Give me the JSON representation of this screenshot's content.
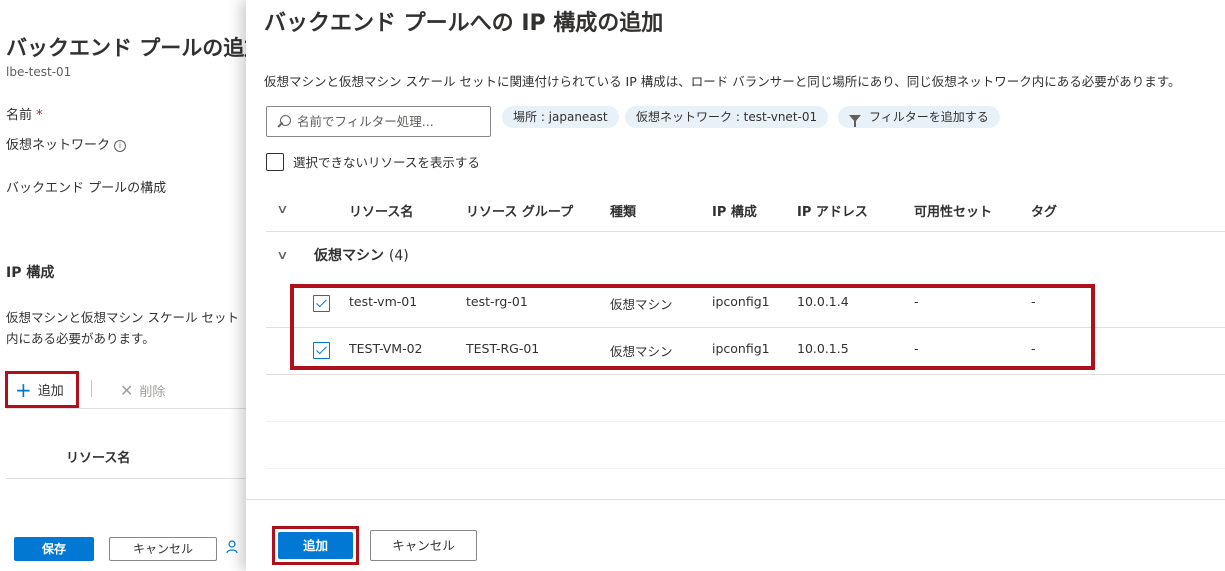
{
  "background_blade": {
    "title": "バックエンド プールの追加",
    "subtitle": "lbe-test-01",
    "name_label": "名前",
    "required_marker": "*",
    "vnet_label": "仮想ネットワーク",
    "info_glyph": "i",
    "config_label": "バックエンド プールの構成",
    "ip_heading": "IP 構成",
    "ip_desc_line1": "仮想マシンと仮想マシン スケール セット",
    "ip_desc_line2": "内にある必要があります。",
    "add_label": "追加",
    "delete_label": "削除",
    "column_resource_name": "リソース名",
    "save_label": "保存",
    "cancel_label": "キャンセル"
  },
  "panel": {
    "title": "バックエンド プールへの IP 構成の追加",
    "description": "仮想マシンと仮想マシン スケール セットに関連付けられている IP 構成は、ロード バランサーと同じ場所にあり、同じ仮想ネットワーク内にある必要があります。",
    "search_placeholder": "名前でフィルター処理...",
    "pills": {
      "location": "場所 : japaneast",
      "vnet": "仮想ネットワーク : test-vnet-01",
      "add_filter": "フィルターを追加する"
    },
    "show_unselectable_label": "選択できないリソースを表示する",
    "columns": {
      "resource_name": "リソース名",
      "resource_group": "リソース グループ",
      "type": "種類",
      "ip_config": "IP 構成",
      "ip_address": "IP アドレス",
      "availability_set": "可用性セット",
      "tags": "タグ"
    },
    "group": {
      "label": "仮想マシン",
      "count": "(4)"
    },
    "rows": [
      {
        "name": "test-vm-01",
        "group": "test-rg-01",
        "type": "仮想マシン",
        "ipconfig": "ipconfig1",
        "ip": "10.0.1.4",
        "avset": "-",
        "tags": "-",
        "checked": true
      },
      {
        "name": "TEST-VM-02",
        "group": "TEST-RG-01",
        "type": "仮想マシン",
        "ipconfig": "ipconfig1",
        "ip": "10.0.1.5",
        "avset": "-",
        "tags": "-",
        "checked": true
      }
    ],
    "add_button": "追加",
    "cancel_button": "キャンセル"
  },
  "colors": {
    "accent": "#0078d4",
    "highlight": "#b0101c"
  }
}
